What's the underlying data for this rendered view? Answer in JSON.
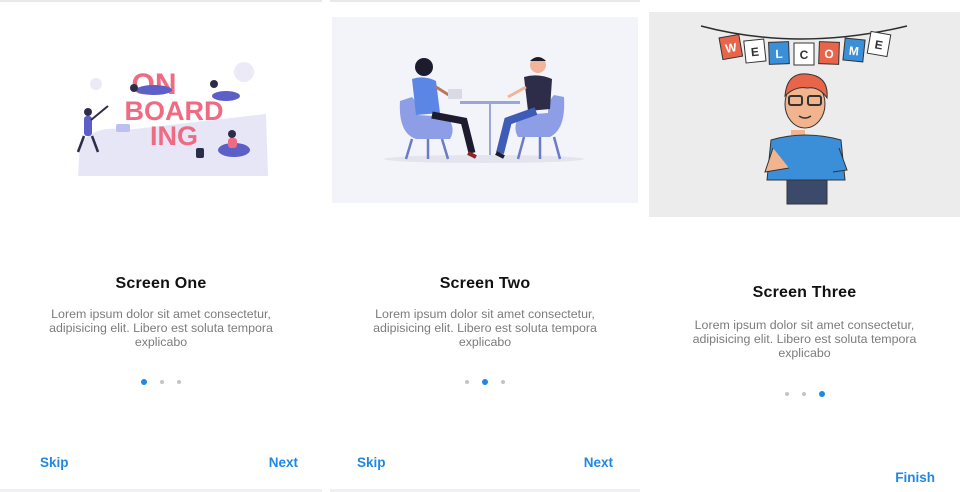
{
  "screens": [
    {
      "title": "Screen One",
      "description": "Lorem ipsum dolor sit amet consectetur, adipisicing elit. Libero est soluta tempora explicabo",
      "active_dot": 1,
      "skip_label": "Skip",
      "next_label": "Next",
      "illustration_text": [
        "ON",
        "BOARD",
        "ING"
      ]
    },
    {
      "title": "Screen Two",
      "description": "Lorem ipsum dolor sit amet consectetur, adipisicing elit. Libero est soluta tempora explicabo",
      "active_dot": 2,
      "skip_label": "Skip",
      "next_label": "Next"
    },
    {
      "title": "Screen Three",
      "description": "Lorem ipsum dolor sit amet consectetur, adipisicing elit. Libero est soluta tempora explicabo",
      "active_dot": 3,
      "finish_label": "Finish",
      "illustration_text": [
        "W",
        "E",
        "L",
        "C",
        "O",
        "M",
        "E"
      ]
    }
  ],
  "colors": {
    "accent": "#1e88e5",
    "dot_inactive": "#c4c4c4",
    "title": "#111111",
    "description": "#7c7c7c"
  }
}
